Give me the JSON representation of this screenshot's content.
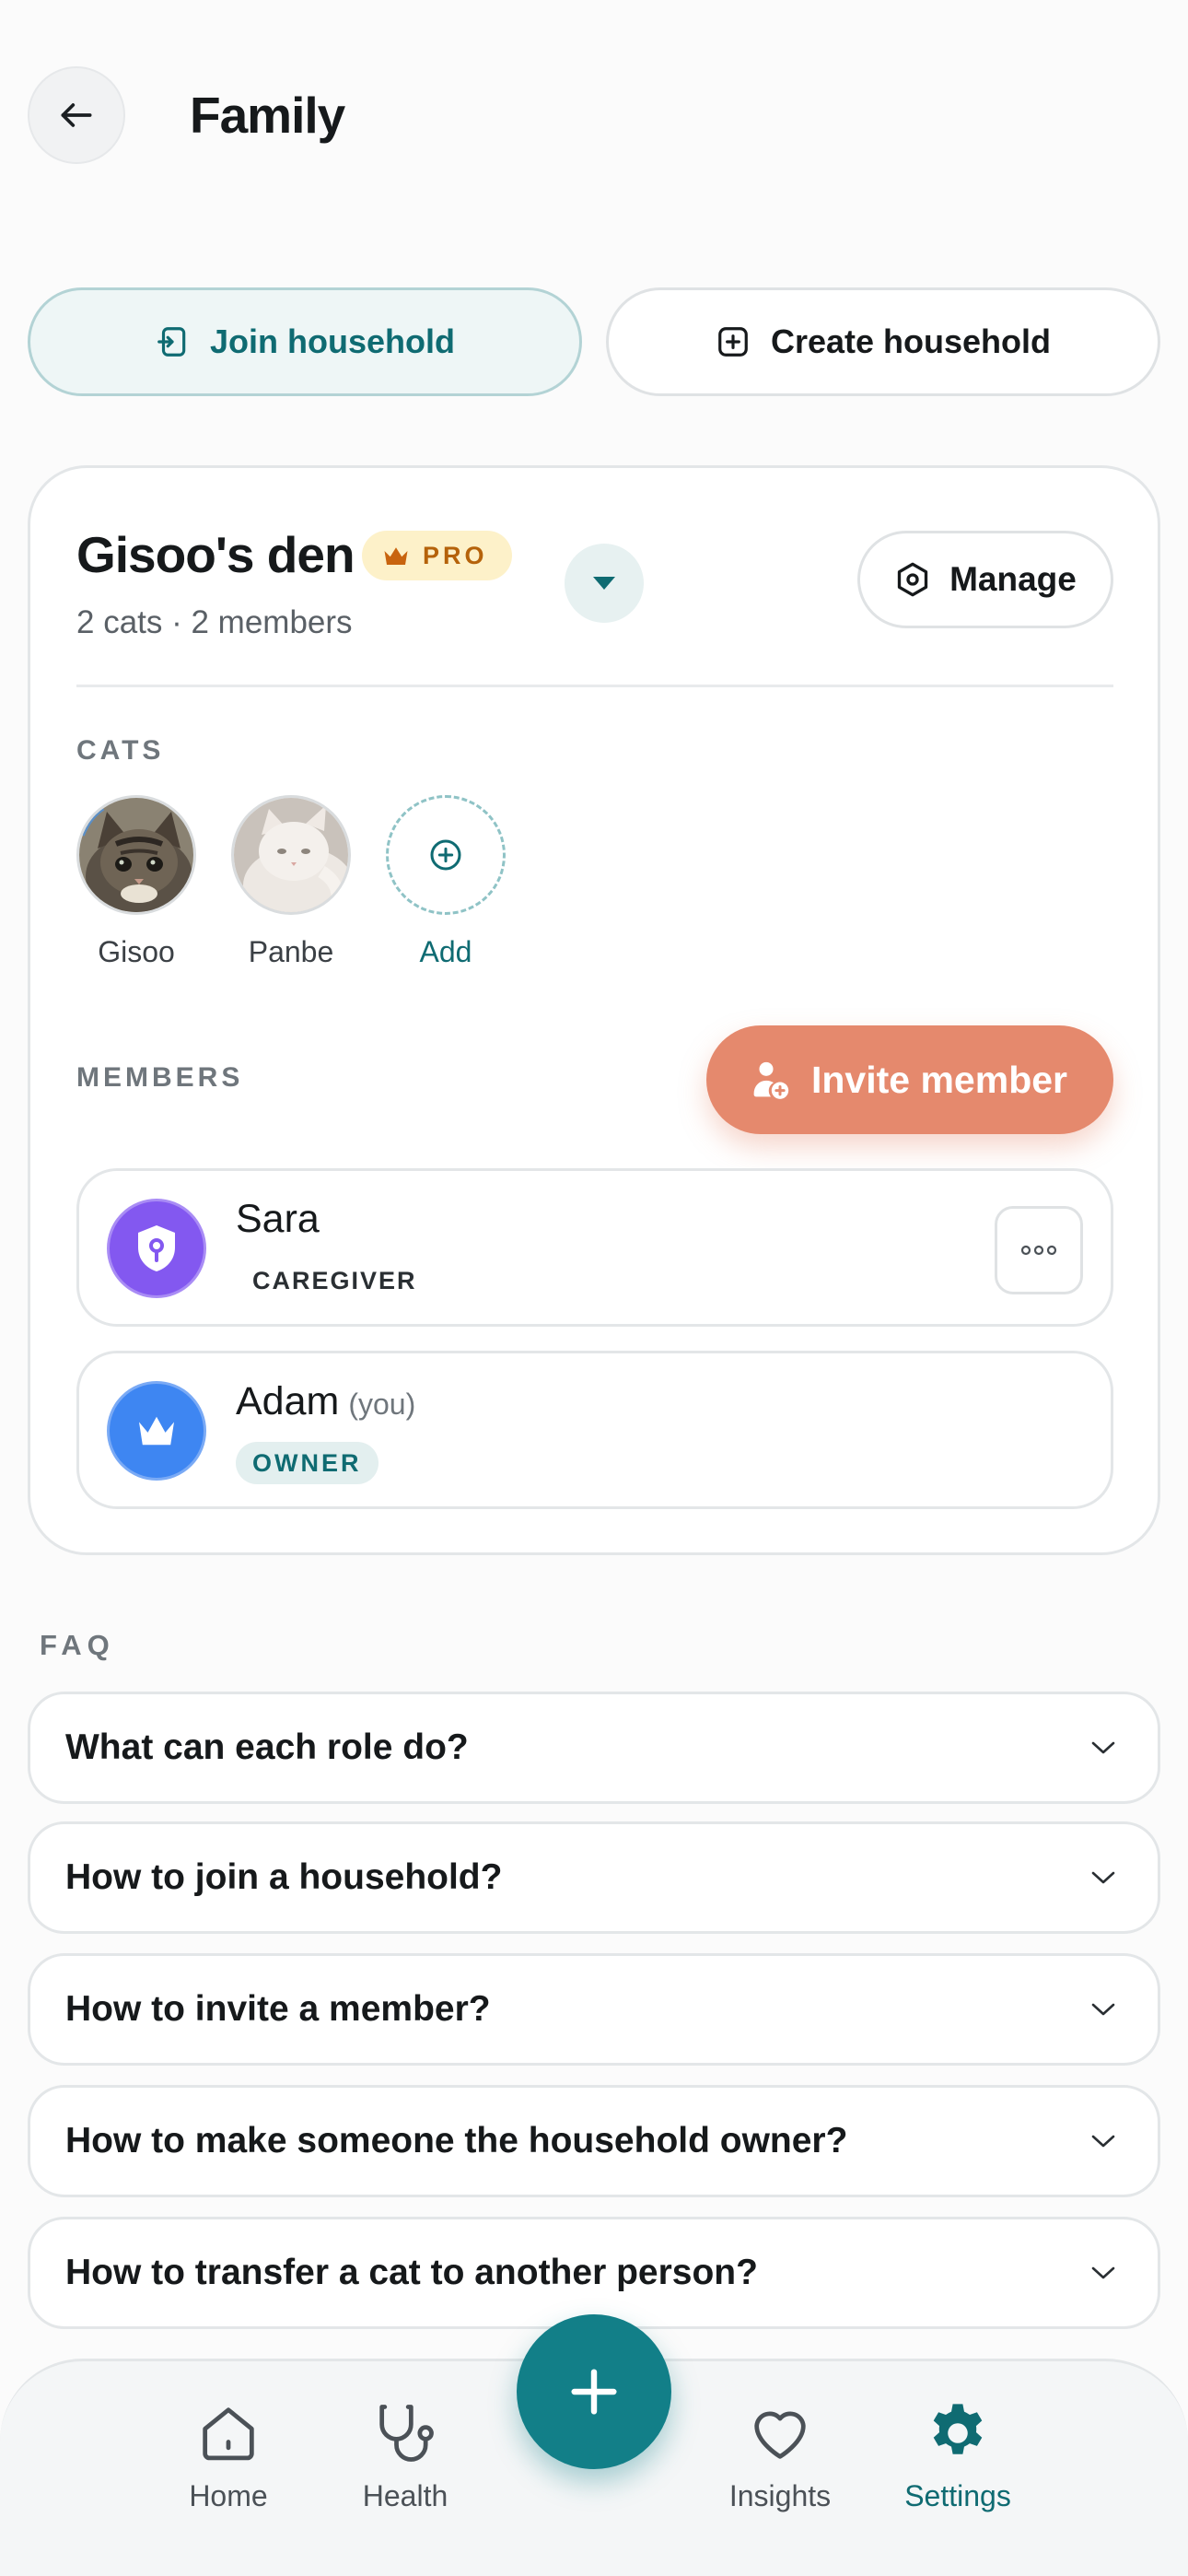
{
  "header": {
    "title": "Family"
  },
  "household_actions": {
    "join_label": "Join household",
    "create_label": "Create household"
  },
  "household": {
    "name": "Gisoo's den",
    "badge": "PRO",
    "summary": "2 cats · 2 members",
    "manage_label": "Manage",
    "cats_label": "CATS",
    "cats": [
      {
        "name": "Gisoo"
      },
      {
        "name": "Panbe"
      }
    ],
    "add_cat_label": "Add",
    "members_label": "MEMBERS",
    "invite_label": "Invite member",
    "members": [
      {
        "name": "Sara",
        "you": "",
        "role": "CAREGIVER",
        "avatar_color": "#8358f0",
        "icon": "shield-icon"
      },
      {
        "name": "Adam",
        "you": "(you)",
        "role": "OWNER",
        "avatar_color": "#3e86f2",
        "icon": "crown-icon"
      }
    ]
  },
  "faq": {
    "label": "FAQ",
    "items": [
      "What can each role do?",
      "How to join a household?",
      "How to invite a member?",
      "How to make someone the household owner?",
      "How to transfer a cat to another person?"
    ]
  },
  "nav": {
    "home": "Home",
    "health": "Health",
    "insights": "Insights",
    "settings": "Settings",
    "active": "Settings"
  },
  "colors": {
    "accent": "#127f88",
    "invite": "#e5896d",
    "pro_bg": "#fdf1c9"
  }
}
